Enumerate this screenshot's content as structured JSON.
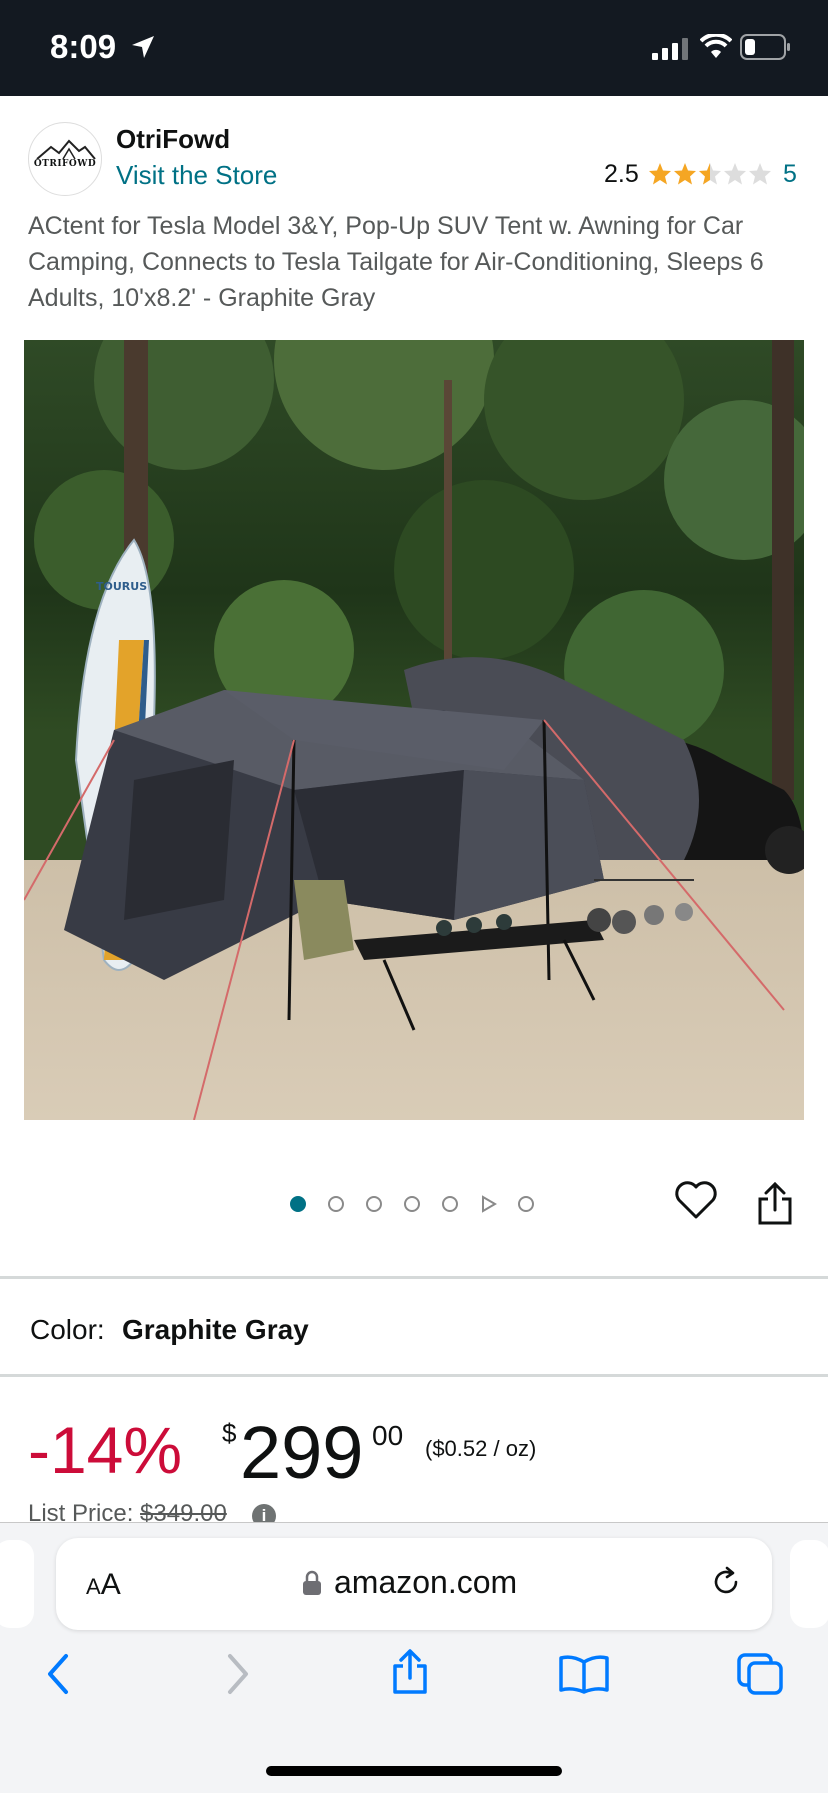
{
  "status_bar": {
    "time": "8:09"
  },
  "brand": {
    "logo_text": "OTRIFOWD",
    "name": "OtriFowd",
    "visit_store": "Visit the Store"
  },
  "rating": {
    "value": "2.5",
    "stars": 2.5,
    "count": "5"
  },
  "product": {
    "title": "ACtent for Tesla Model 3&Y, Pop-Up SUV Tent w. Awning for Car Camping, Connects to Tesla Tailgate for Air-Conditioning, Sleeps 6 Adults, 10'x8.2' - Graphite Gray"
  },
  "gallery": {
    "image_count": 7,
    "active_index": 0,
    "video_index": 5,
    "board_text": "TOURUS"
  },
  "color": {
    "label": "Color:",
    "value": "Graphite Gray"
  },
  "price": {
    "discount": "-14%",
    "currency": "$",
    "whole": "299",
    "fraction": "00",
    "unit_price": "($0.52 / oz)",
    "list_label": "List Price:",
    "list_value": "$349.00",
    "info_icon": "i"
  },
  "browser": {
    "aa_small": "A",
    "aa_large": "A",
    "url": "amazon.com"
  },
  "colors": {
    "link": "#007185",
    "discount": "#cc0c39",
    "star": "#f5a623",
    "status_bar": "#131921",
    "ios_blue": "#007aff"
  },
  "icons": [
    "location-arrow-icon",
    "signal-icon",
    "wifi-icon",
    "battery-icon",
    "star-icon",
    "heart-icon",
    "share-icon",
    "play-icon",
    "lock-icon",
    "reload-icon",
    "back-icon",
    "forward-icon",
    "bookmarks-icon",
    "tabs-icon",
    "info-icon"
  ]
}
